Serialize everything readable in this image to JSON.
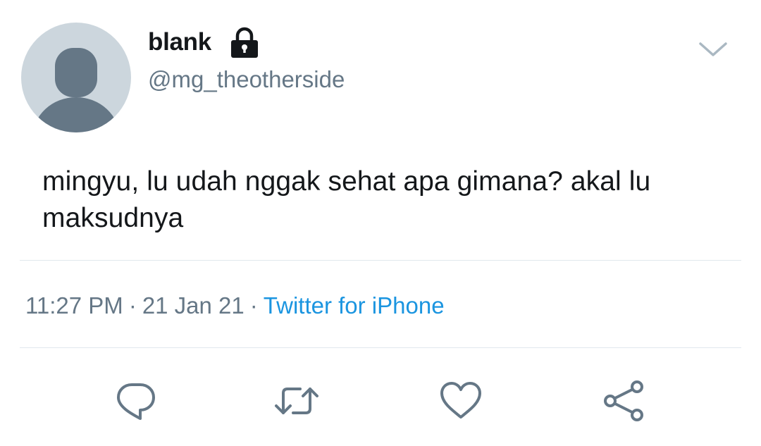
{
  "tweet": {
    "author": {
      "display_name": "blank",
      "handle": "@mg_theotherside",
      "protected": true,
      "avatar": "default-profile-silhouette"
    },
    "text": "mingyu, lu udah nggak sehat apa gimana? akal lu maksudnya",
    "time": "11:27 PM",
    "separator": "·",
    "date": "21 Jan 21",
    "source": "Twitter for iPhone"
  },
  "icons": {
    "lock": "lock-icon",
    "more": "chevron-down-icon",
    "reply": "reply-icon",
    "retweet": "retweet-icon",
    "like": "heart-icon",
    "share": "share-icon"
  },
  "colors": {
    "text_primary": "#14171a",
    "text_secondary": "#657786",
    "link": "#1b95e0",
    "avatar_bg": "#ccd6dd",
    "avatar_fg": "#657786",
    "divider": "#e1e8ed"
  }
}
